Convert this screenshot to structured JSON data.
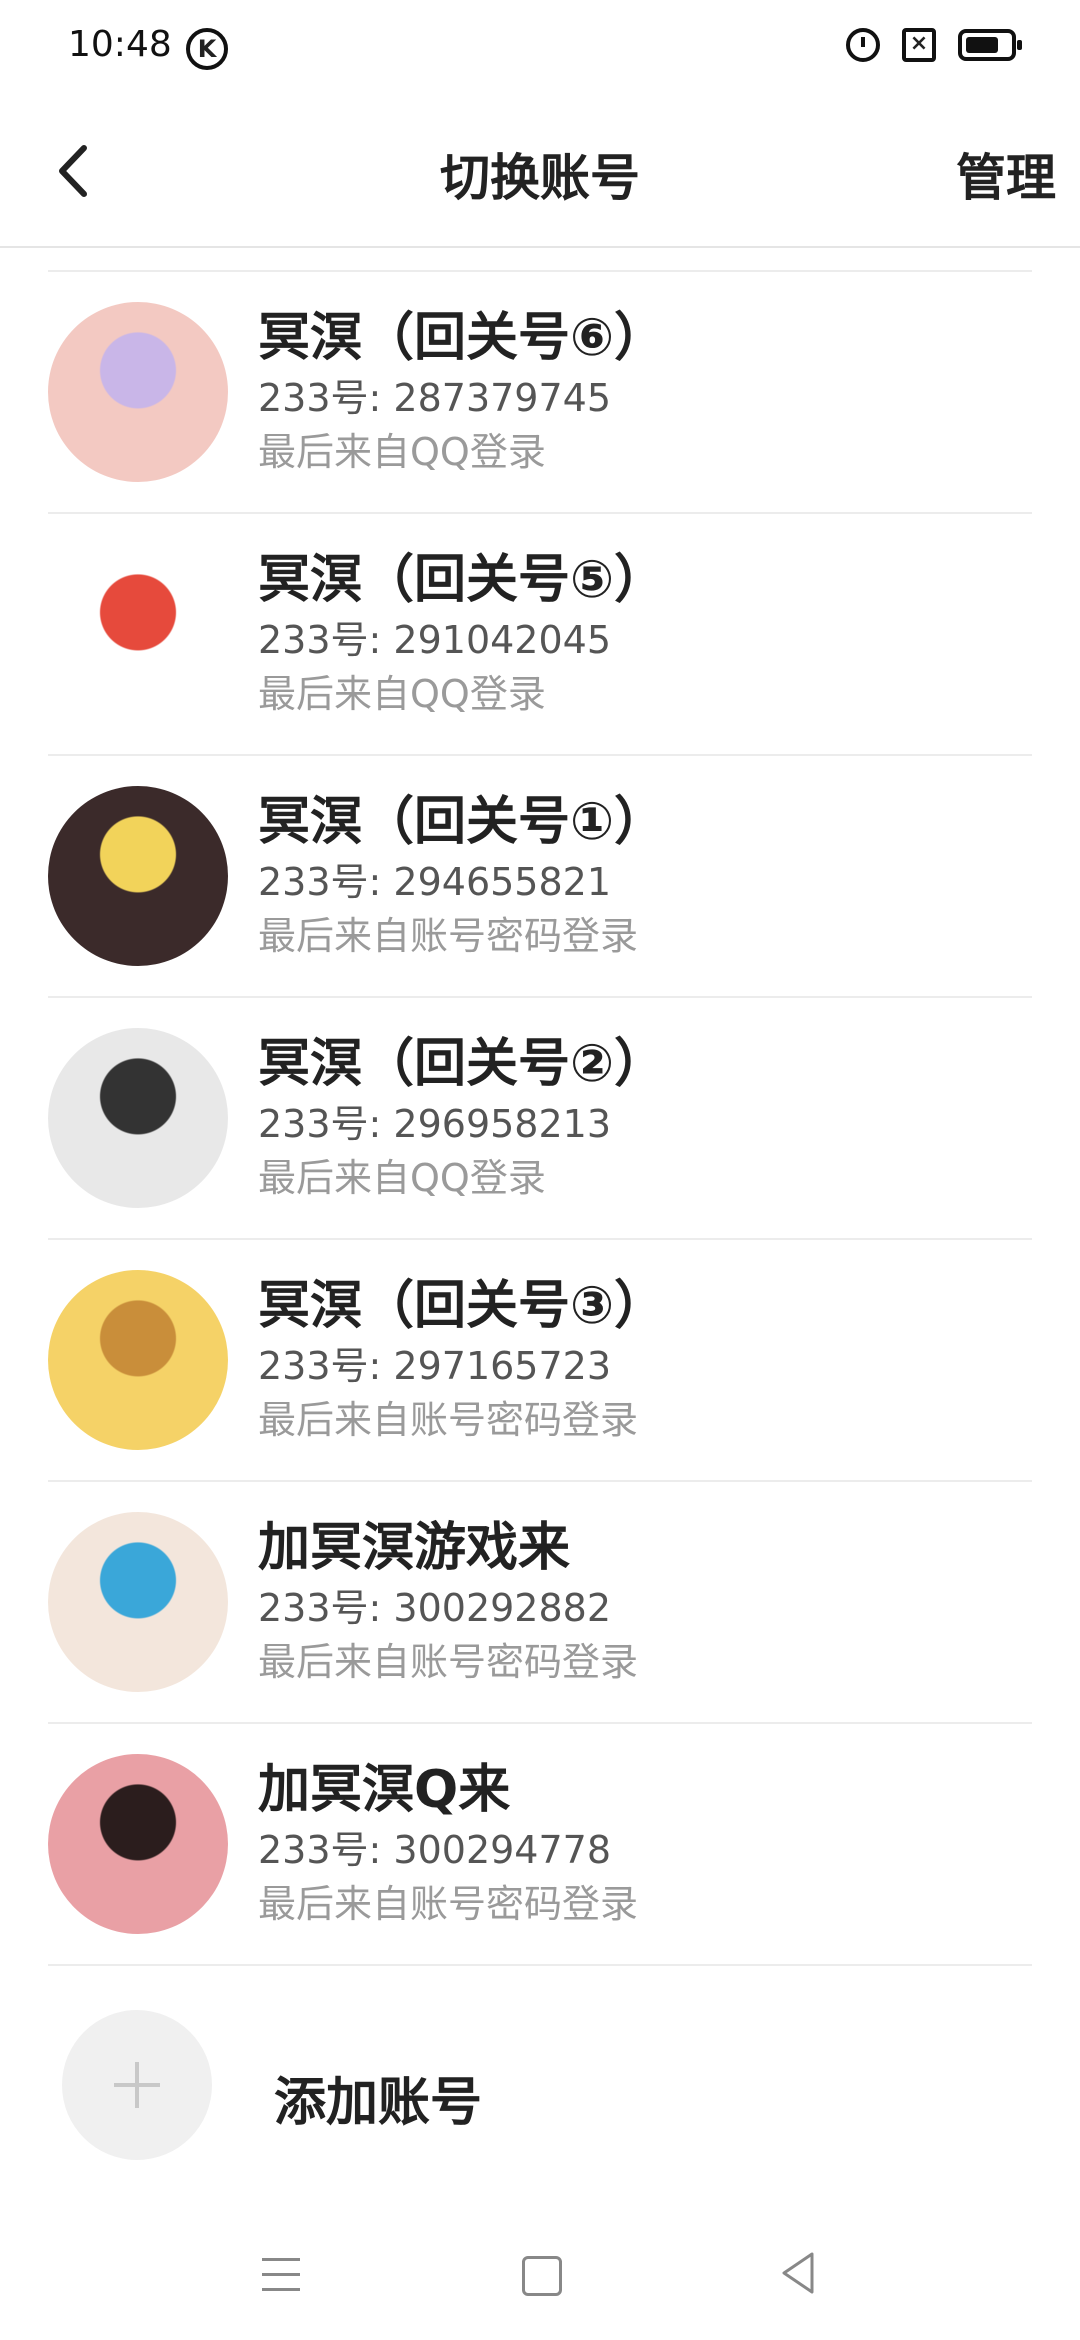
{
  "status_bar": {
    "time": "10:48",
    "k_badge": "K",
    "x_badge": "×"
  },
  "header": {
    "title": "切换账号",
    "manage_label": "管理",
    "back_icon": "chevron-left-icon"
  },
  "accounts": [
    {
      "name": "冥溟（回关号⑥）",
      "uid": "233号: 287379745",
      "login": "最后来自QQ登录",
      "avatar_colors": [
        "#f3c9c2",
        "#c9b6e8"
      ]
    },
    {
      "name": "冥溟（回关号⑤）",
      "uid": "233号: 291042045",
      "login": "最后来自QQ登录",
      "avatar_colors": [
        "#ffffff",
        "#e64a3c"
      ]
    },
    {
      "name": "冥溟（回关号①）",
      "uid": "233号: 294655821",
      "login": "最后来自账号密码登录",
      "avatar_colors": [
        "#3b2a2a",
        "#f2d35a"
      ]
    },
    {
      "name": "冥溟（回关号②）",
      "uid": "233号: 296958213",
      "login": "最后来自QQ登录",
      "avatar_colors": [
        "#e8e8e8",
        "#333333"
      ]
    },
    {
      "name": "冥溟（回关号③）",
      "uid": "233号: 297165723",
      "login": "最后来自账号密码登录",
      "avatar_colors": [
        "#f5d267",
        "#c98e3a"
      ]
    },
    {
      "name": "加冥溟游戏来",
      "uid": "233号: 300292882",
      "login": "最后来自账号密码登录",
      "avatar_colors": [
        "#f3e6dc",
        "#3aa7d9"
      ]
    },
    {
      "name": "加冥溟Q来",
      "uid": "233号: 300294778",
      "login": "最后来自账号密码登录",
      "avatar_colors": [
        "#e9a0a5",
        "#2b1d1d"
      ]
    }
  ],
  "add_account": {
    "label": "添加账号",
    "icon": "plus-icon"
  },
  "navbar": {
    "menu_icon": "menu-icon",
    "home_icon": "home-icon",
    "back_icon": "back-triangle-icon"
  }
}
